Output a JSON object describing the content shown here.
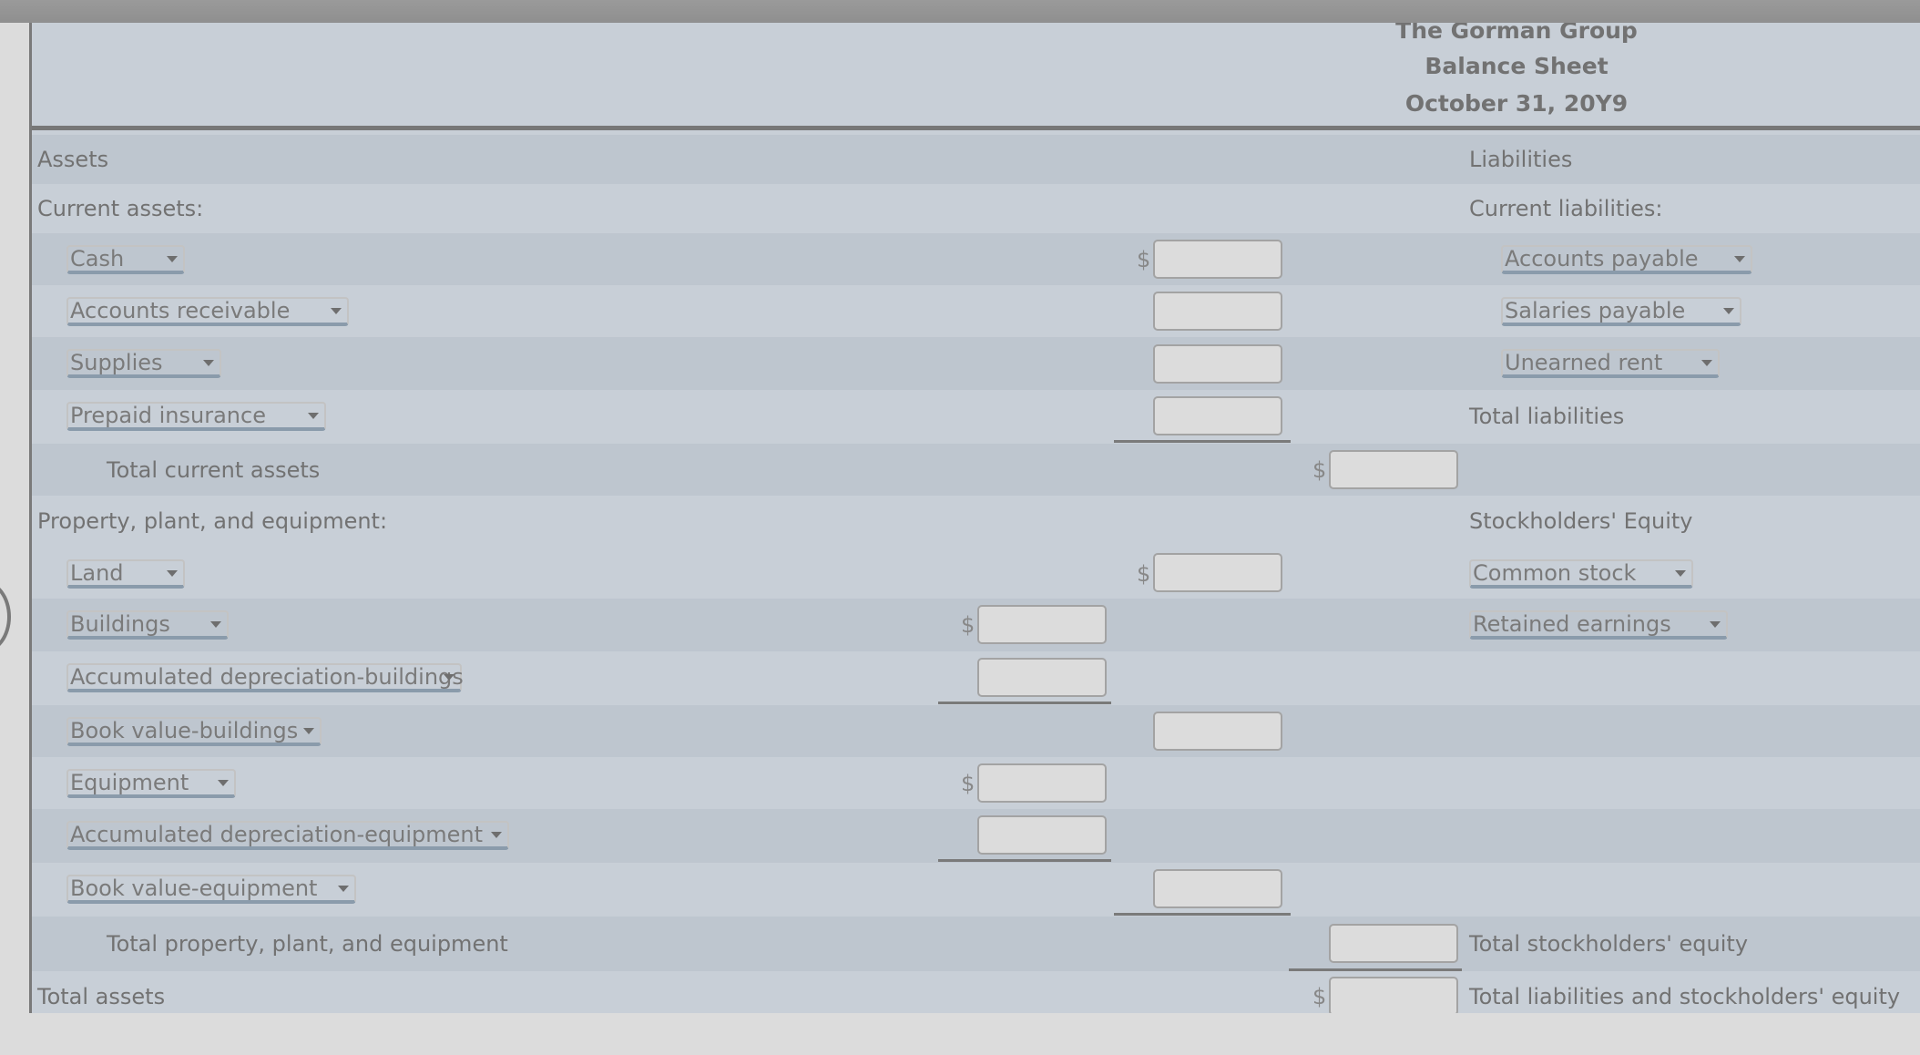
{
  "header": {
    "company": "The Gorman Group",
    "title": "Balance Sheet",
    "date": "October 31, 20Y9"
  },
  "assets": {
    "heading": "Assets",
    "current_heading": "Current assets:",
    "current_items": [
      {
        "select": "Cash",
        "dollar": "$",
        "value": ""
      },
      {
        "select": "Accounts receivable",
        "value": ""
      },
      {
        "select": "Supplies",
        "value": ""
      },
      {
        "select": "Prepaid insurance",
        "value": ""
      }
    ],
    "total_current": {
      "label": "Total current assets",
      "dollar": "$",
      "value": ""
    },
    "ppe_heading": "Property, plant, and equipment:",
    "ppe_items": [
      {
        "select": "Land",
        "dollar": "$",
        "value": ""
      },
      {
        "select": "Buildings",
        "dollar": "$",
        "value": ""
      },
      {
        "select": "Accumulated depreciation-buildings",
        "value": ""
      },
      {
        "select": "Book value-buildings",
        "value": ""
      },
      {
        "select": "Equipment",
        "dollar": "$",
        "value": ""
      },
      {
        "select": "Accumulated depreciation-equipment",
        "value": ""
      },
      {
        "select": "Book value-equipment",
        "value": ""
      }
    ],
    "total_ppe": {
      "label": "Total property, plant, and equipment",
      "value": ""
    },
    "total_assets": {
      "label": "Total assets",
      "dollar": "$",
      "value": ""
    }
  },
  "liabilities": {
    "heading": "Liabilities",
    "current_heading": "Current liabilities:",
    "items": [
      {
        "select": "Accounts payable"
      },
      {
        "select": "Salaries payable"
      },
      {
        "select": "Unearned rent"
      }
    ],
    "total": "Total liabilities"
  },
  "equity": {
    "heading": "Stockholders' Equity",
    "items": [
      {
        "select": "Common stock"
      },
      {
        "select": "Retained earnings"
      }
    ],
    "total": "Total stockholders' equity",
    "total_liab_equity": "Total liabilities and stockholders' equity"
  },
  "colors": {
    "row_dark": "#bec6cf",
    "row_light": "#c8cfd7",
    "input_fill": "#dcdcdc",
    "text": "#727272"
  }
}
